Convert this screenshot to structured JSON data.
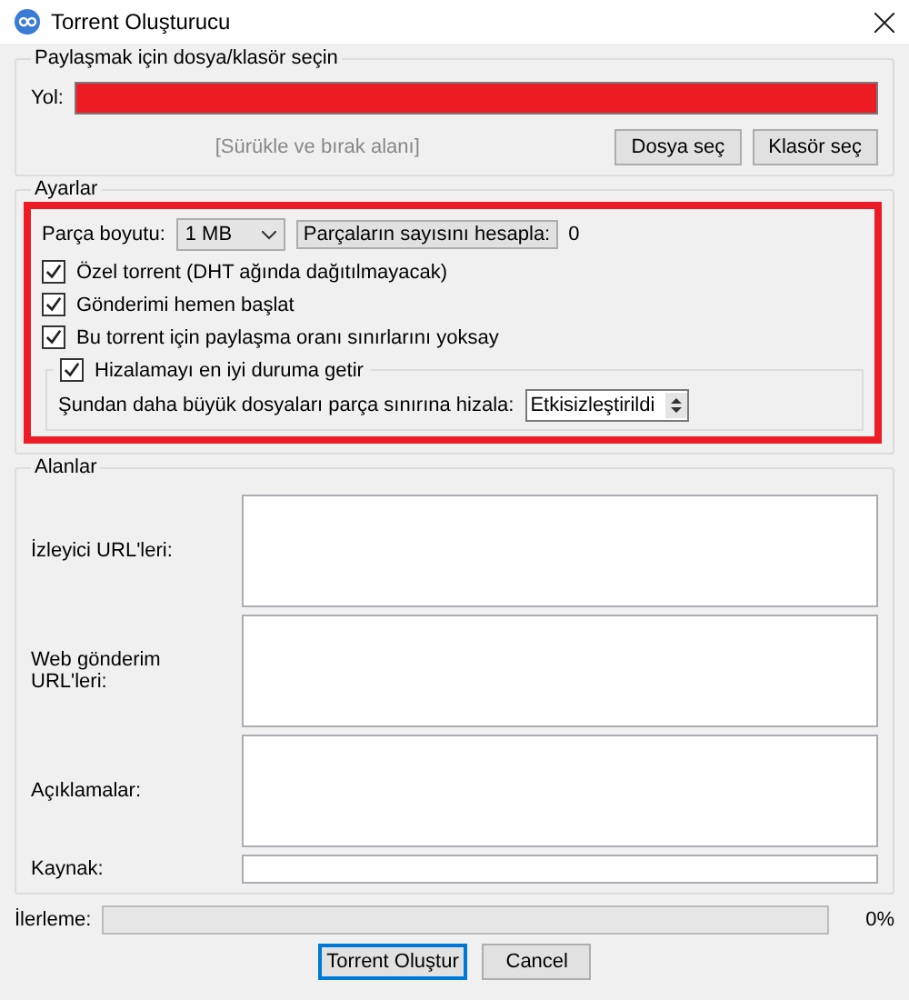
{
  "window": {
    "title": "Torrent Oluşturucu"
  },
  "source": {
    "title": "Paylaşmak için dosya/klasör seçin",
    "path_label": "Yol:",
    "drop_hint": "[Sürükle ve bırak alanı]",
    "buttons": [
      "Dosya seç",
      "Klasör seç"
    ]
  },
  "settings": {
    "title": "Ayarlar",
    "piece_size_label": "Parça boyutu:",
    "piece_size": "1 MB",
    "calc_button": "Parçaların sayısını hesapla:",
    "piece_count": "0",
    "options": [
      {
        "label": "Özel torrent (DHT ağında dağıtılmayacak)",
        "checked": true
      },
      {
        "label": "Gönderimi hemen başlat",
        "checked": true
      },
      {
        "label": "Bu torrent için paylaşma oranı sınırlarını yoksay",
        "checked": true
      }
    ],
    "alignment": {
      "label": "Hizalamayı en iyi duruma getir",
      "checked": true,
      "threshold_label": "Şundan daha büyük dosyaları parça sınırına hizala:",
      "threshold_value": "Etkisizleştirildi"
    }
  },
  "fields": {
    "title": "Alanlar",
    "items": [
      {
        "label": "İzleyici URL'leri:",
        "kind": "multiline"
      },
      {
        "label": "Web gönderim URL'leri:",
        "kind": "multiline"
      },
      {
        "label": "Açıklamalar:",
        "kind": "multiline"
      },
      {
        "label": "Kaynak:",
        "kind": "line"
      }
    ]
  },
  "progress": {
    "label": "İlerleme:",
    "level": 0,
    "reading": "0%"
  },
  "buttons": [
    {
      "label": "Torrent Oluştur",
      "default": true
    },
    {
      "label": "Cancel",
      "default": false
    }
  ]
}
